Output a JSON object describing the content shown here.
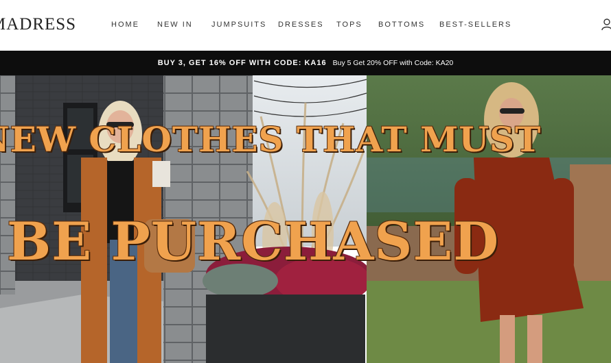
{
  "header": {
    "logo": "MADRESS",
    "nav": [
      "HOME",
      "NEW IN",
      "JUMPSUITS",
      "DRESSES",
      "TOPS",
      "BOTTOMS",
      "BEST-SELLERS"
    ]
  },
  "promo": {
    "main": "BUY 3, GET 16% OFF WITH CODE: KA16",
    "secondary": "Buy 5 Get 20% OFF with Code: KA20"
  },
  "hero": {
    "headline_line1": "NEW CLOTHES THAT MUST",
    "headline_line2": "BE PURCHASED"
  },
  "colors": {
    "headline": "#f0a24e",
    "promo_bar": "#0d0d0d",
    "cardigan": "#b5652a",
    "dress": "#8a2a12"
  },
  "icons": {
    "account": "user-icon"
  }
}
